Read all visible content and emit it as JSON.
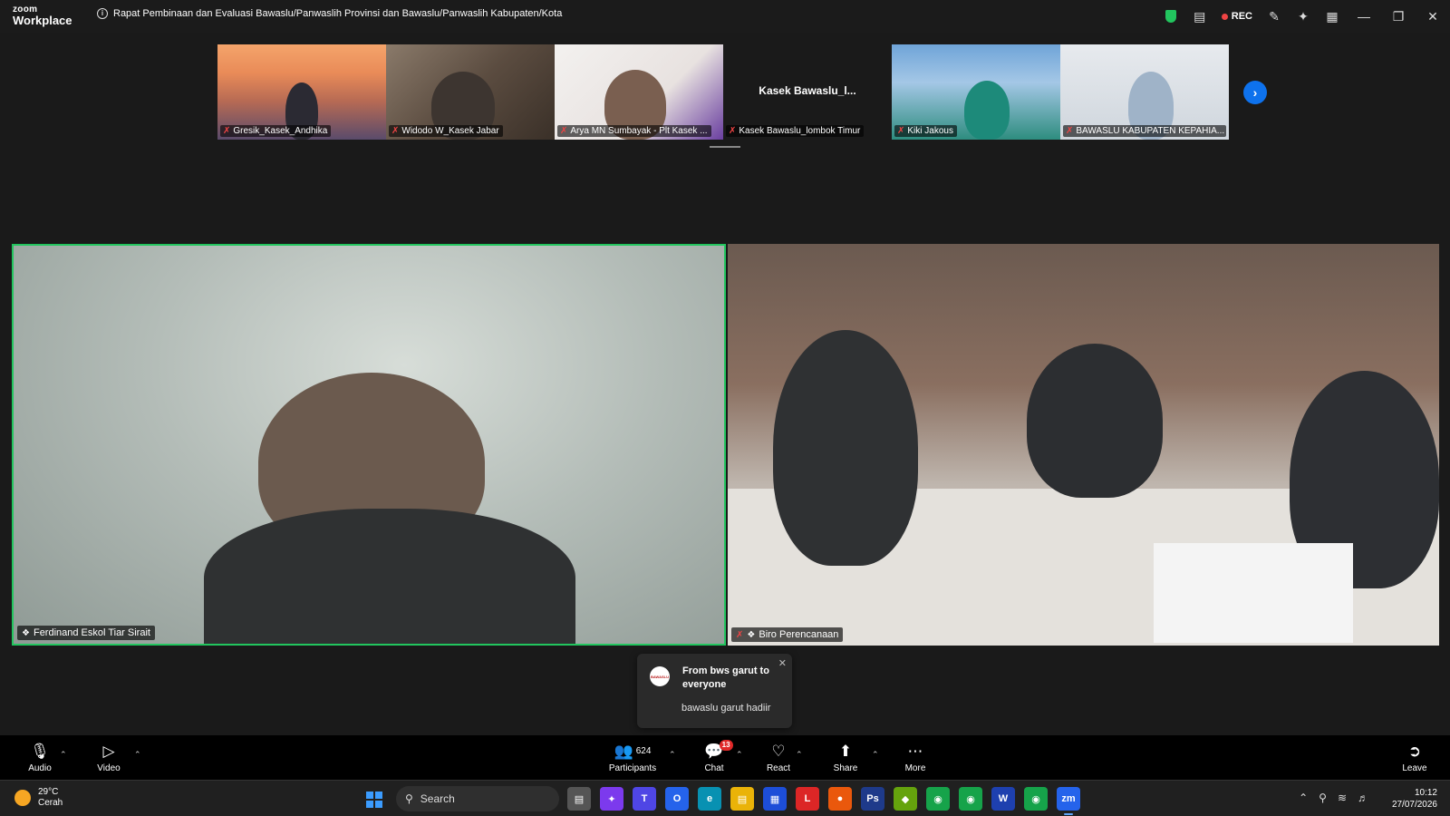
{
  "app": {
    "logo_top": "zoom",
    "logo_bottom": "Workplace",
    "meeting_title": "Rapat Pembinaan dan Evaluasi Bawaslu/Panwaslih Provinsi dan Bawaslu/Panwaslih Kabupaten/Kota",
    "rec_label": "REC"
  },
  "filmstrip": [
    {
      "name": "Gresik_Kasek_Andhika",
      "muted": true
    },
    {
      "name": "Widodo W_Kasek Jabar",
      "muted": true
    },
    {
      "name": "Arya MN Sumbayak - Plt Kasek ...",
      "muted": true
    },
    {
      "name": "Kasek Bawaslu_lombok Timur",
      "muted": true,
      "video_off_label": "Kasek  Bawaslu_l..."
    },
    {
      "name": "Kiki Jakous",
      "muted": true
    },
    {
      "name": "BAWASLU KABUPATEN KEPAHIA...",
      "muted": true
    }
  ],
  "main_videos": [
    {
      "name": "Ferdinand Eskol Tiar Sirait",
      "pinned": true,
      "active_speaker": true
    },
    {
      "name": "Biro Perencanaan",
      "pinned": true,
      "muted": true
    }
  ],
  "toast": {
    "avatar_text": "BAWASLU",
    "from": "From bws garut to everyone",
    "message": "bawaslu garut hadiir"
  },
  "toolbar": {
    "audio": "Audio",
    "video": "Video",
    "participants": "Participants",
    "participants_count": "624",
    "chat": "Chat",
    "chat_badge": "13",
    "react": "React",
    "share": "Share",
    "more": "More",
    "leave": "Leave"
  },
  "taskbar": {
    "temp": "29°C",
    "condition": "Cerah",
    "search_placeholder": "Search",
    "time": "10:12",
    "date": "27/07/2026"
  },
  "colors": {
    "accent_blue": "#0e72ed",
    "active_speaker_green": "#22c55e",
    "muted_red": "#ef4444"
  }
}
